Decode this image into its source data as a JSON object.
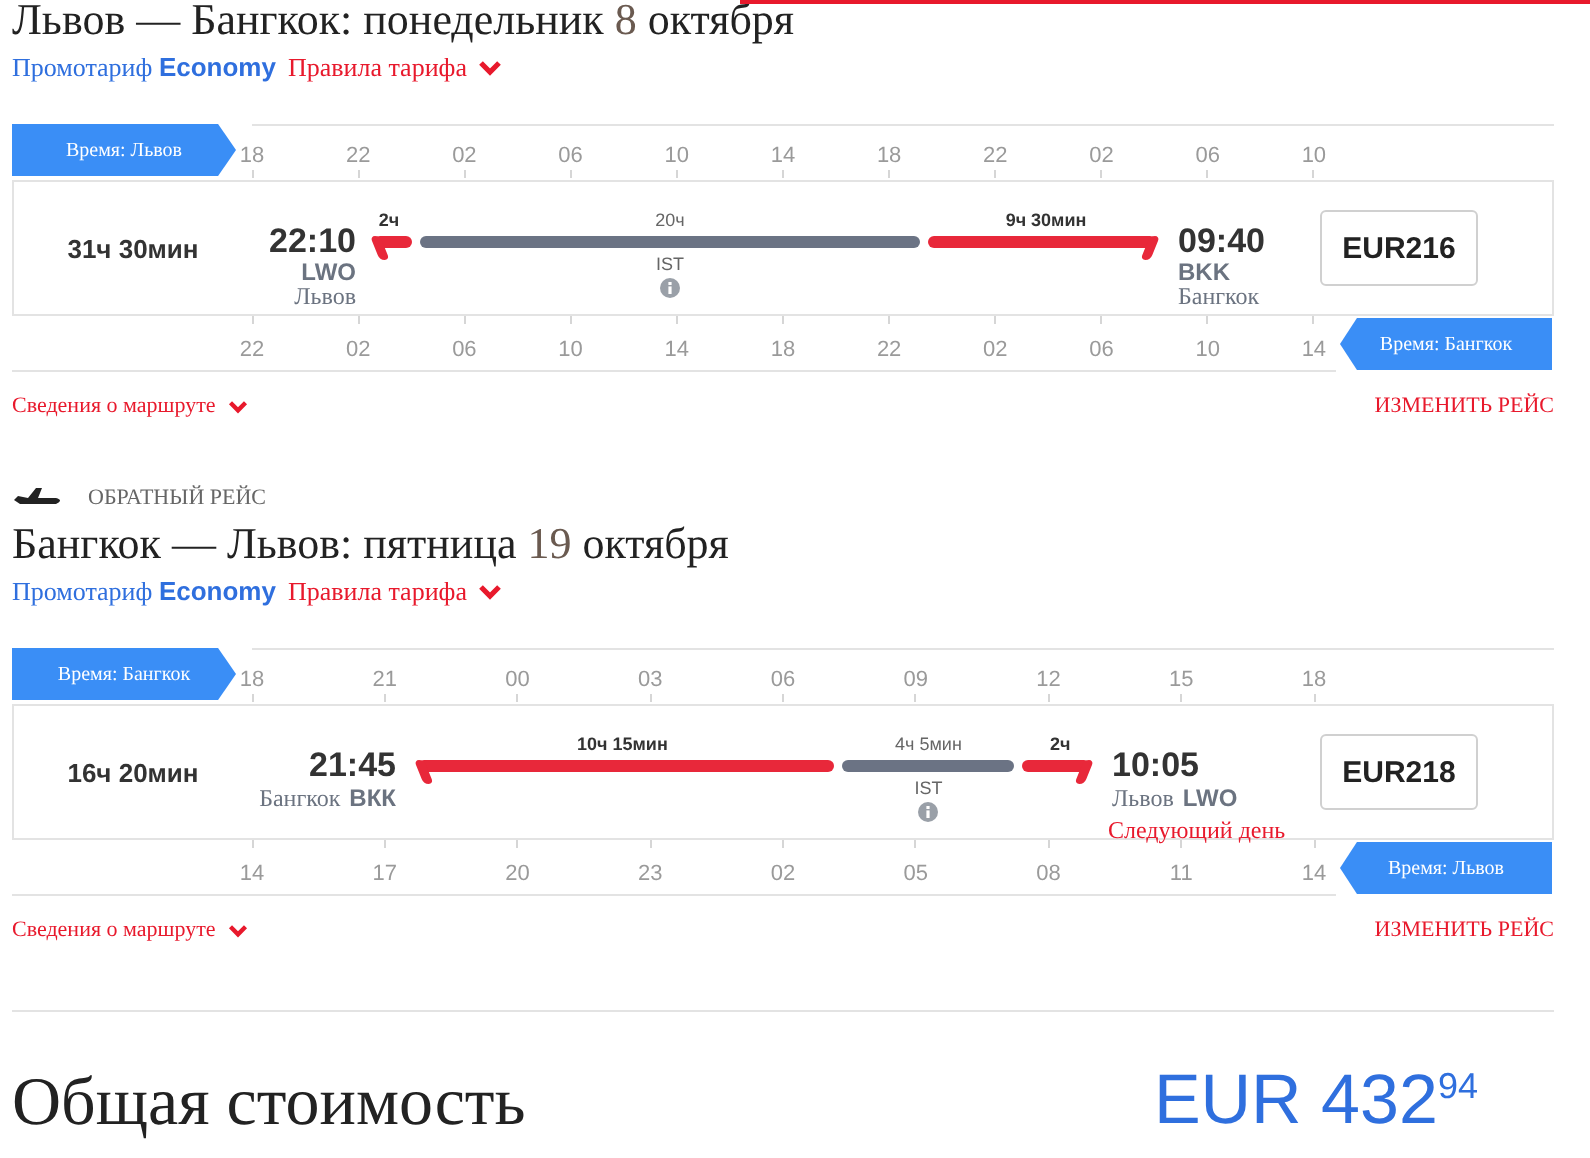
{
  "flights": [
    {
      "route": "Львов — Бангкок:",
      "weekday": "понедельник",
      "day": "8",
      "month": "октября",
      "fare_label": "Промотариф",
      "fare_name": "Economy",
      "fare_rules": "Правила тарифа",
      "top_axis": {
        "tag": "Время: Львов",
        "ticks": [
          "18",
          "22",
          "02",
          "06",
          "10",
          "14",
          "18",
          "22",
          "02",
          "06",
          "10"
        ]
      },
      "duration": "31ч 30мин",
      "departure": {
        "kind": "stacked",
        "time": "22:10",
        "code": "LWO",
        "city": "Львов"
      },
      "segments": [
        {
          "kind": "flight",
          "label": "2ч"
        },
        {
          "kind": "layover",
          "label": "20ч",
          "airport": "IST"
        },
        {
          "kind": "flight",
          "label": "9ч 30мин"
        }
      ],
      "arrival": {
        "kind": "stacked",
        "time": "09:40",
        "code": "BKK",
        "city": "Бангкок"
      },
      "price": "EUR216",
      "bottom_axis": {
        "tag": "Время: Бангкок",
        "ticks": [
          "22",
          "02",
          "06",
          "10",
          "14",
          "18",
          "22",
          "02",
          "06",
          "10",
          "14"
        ]
      },
      "details_link": "Сведения о маршруте",
      "change_link": "ИЗМЕНИТЬ РЕЙС"
    },
    {
      "section_label": "ОБРАТНЫЙ РЕЙС",
      "route": "Бангкок — Львов:",
      "weekday": "пятница",
      "day": "19",
      "month": "октября",
      "fare_label": "Промотариф",
      "fare_name": "Economy",
      "fare_rules": "Правила тарифа",
      "top_axis": {
        "tag": "Время: Бангкок",
        "ticks": [
          "18",
          "21",
          "00",
          "03",
          "06",
          "09",
          "12",
          "15",
          "18"
        ]
      },
      "duration": "16ч 20мин",
      "departure": {
        "kind": "inline",
        "time": "21:45",
        "code": "ВКК",
        "city": "Бангкок"
      },
      "segments": [
        {
          "kind": "flight",
          "label": "10ч 15мин"
        },
        {
          "kind": "layover",
          "label": "4ч 5мин",
          "airport": "IST"
        },
        {
          "kind": "flight",
          "label": "2ч"
        }
      ],
      "arrival": {
        "kind": "inline",
        "time": "10:05",
        "code": "LWO",
        "city": "Львов",
        "note": "Следующий день"
      },
      "price": "EUR218",
      "bottom_axis": {
        "tag": "Время: Львов",
        "ticks": [
          "14",
          "17",
          "20",
          "23",
          "02",
          "05",
          "08",
          "11",
          "14"
        ]
      },
      "details_link": "Сведения о маршруте",
      "change_link": "ИЗМЕНИТЬ РЕЙС"
    }
  ],
  "total": {
    "label": "Общая стоимость",
    "amount": "EUR 432$^{94}$"
  }
}
